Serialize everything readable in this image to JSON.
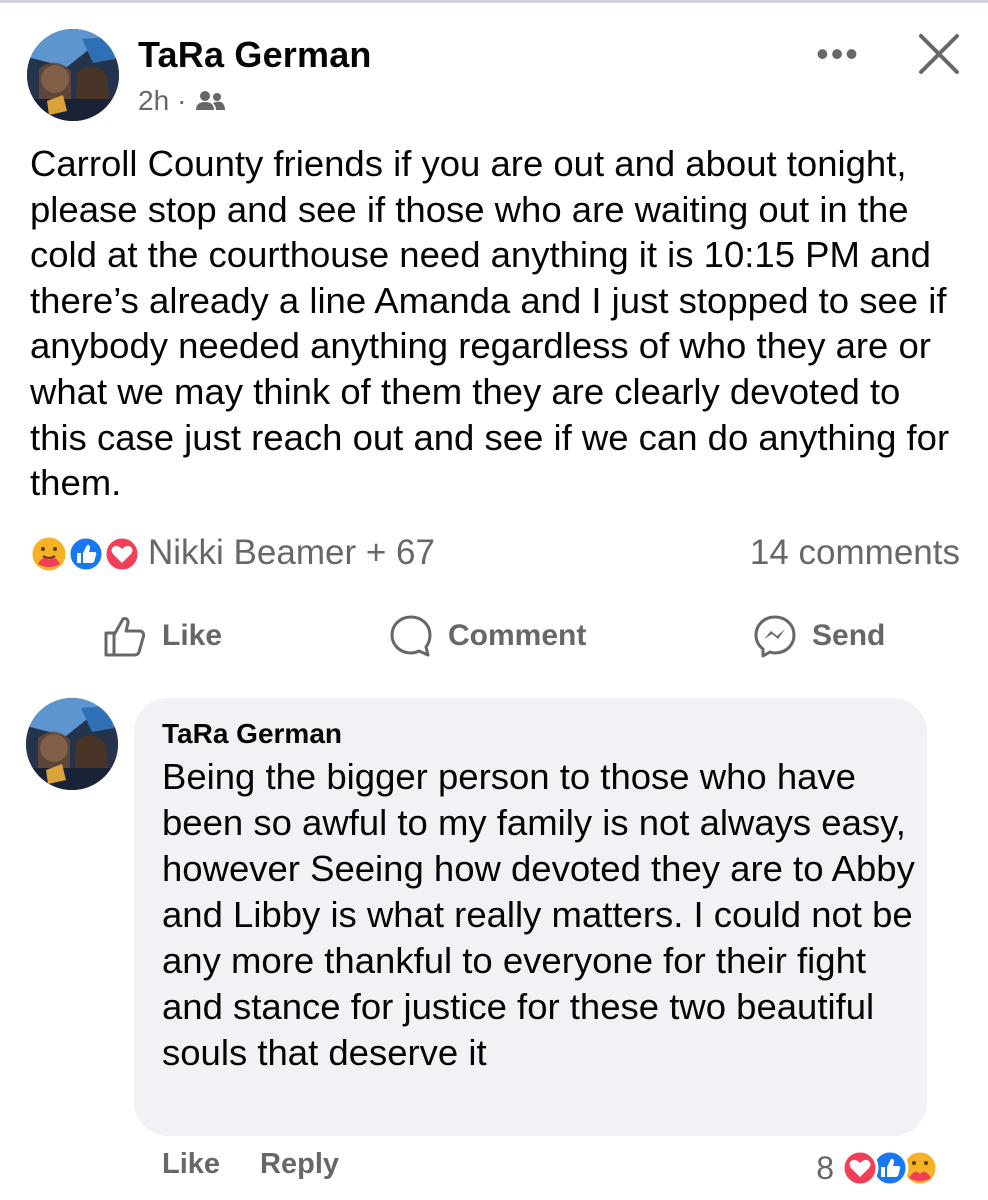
{
  "post": {
    "author": "TaRa German",
    "time": "2h",
    "separator": "·",
    "audience_icon": "friends-icon",
    "more_icon": "more-icon",
    "more_label": "•••",
    "close_icon": "close-icon",
    "text": "Carroll County friends if you are out and about tonight, please stop and see if those who are waiting out in the cold at the courthouse need anything it is 10:15 PM and there’s already a line Amanda and I just stopped to see if anybody needed anything regardless of who they are or what we may think of them they are clearly devoted to this case just reach out and see if we can do anything for them.",
    "reactions": {
      "icons": [
        "care-icon",
        "like-icon",
        "love-icon"
      ],
      "names": "Nikki Beamer + 67",
      "comments": "14 comments"
    },
    "actions": {
      "like": "Like",
      "comment": "Comment",
      "send": "Send"
    }
  },
  "comment": {
    "author": "TaRa German",
    "text": "Being the bigger person to those who have been so awful to my family is not always easy, however Seeing how devoted they are to Abby and Libby is what really matters. I could not be any more thankful to everyone for their fight and stance for justice for these two beautiful souls that deserve it",
    "like_label": "Like",
    "reply_label": "Reply",
    "reaction_count": "8",
    "reaction_icons": [
      "love-icon",
      "like-icon",
      "care-icon"
    ]
  },
  "colors": {
    "text_primary": "#050505",
    "text_secondary": "#65676b",
    "bubble": "#f0f2f5",
    "like_blue": "#1877f2",
    "love_red": "#f33e58",
    "care_yellow": "#f7b125"
  }
}
